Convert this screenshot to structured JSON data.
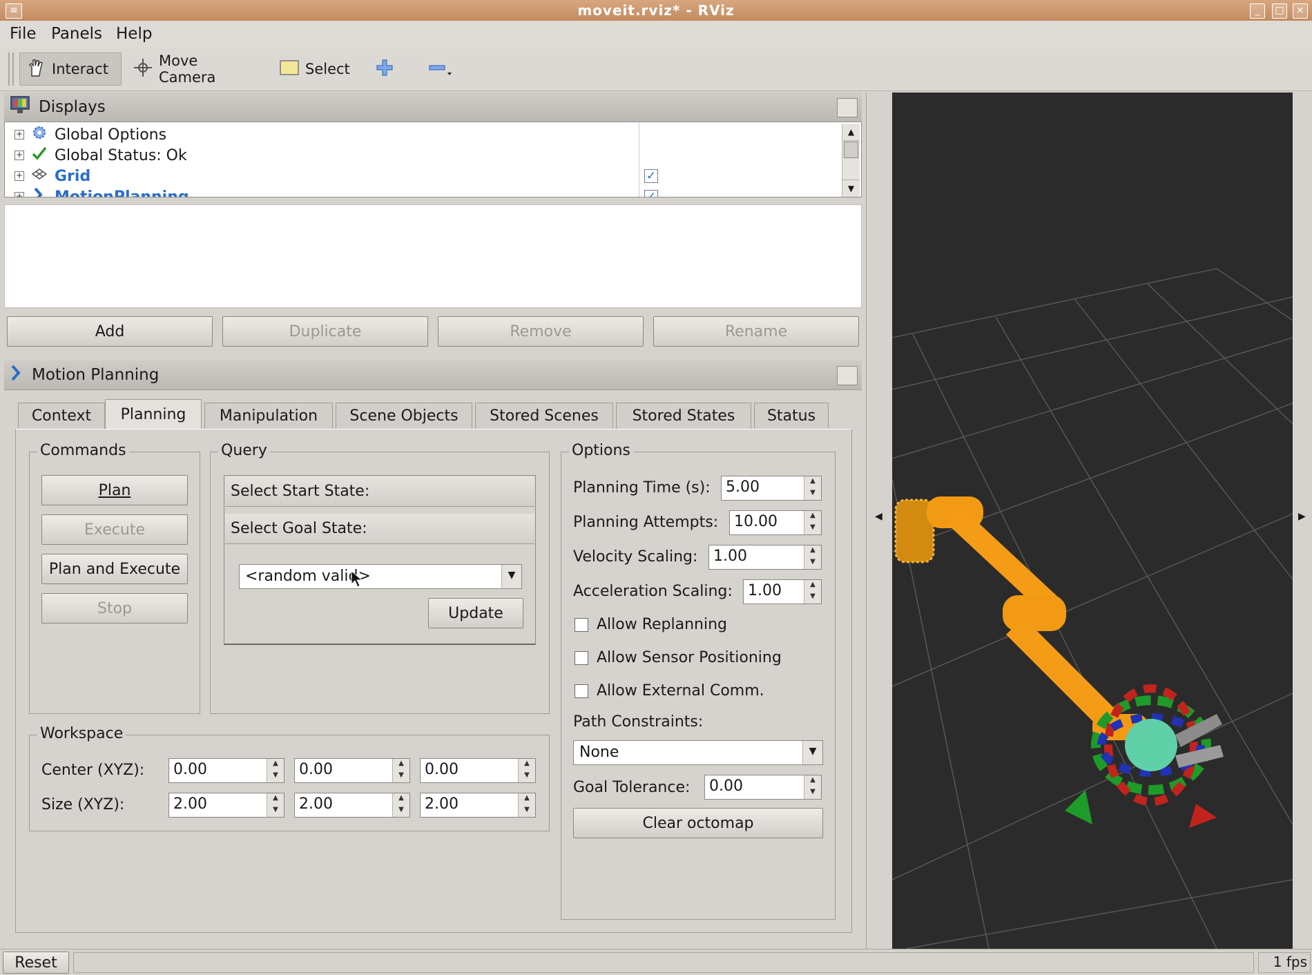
{
  "window": {
    "title": "moveit.rviz* - RViz"
  },
  "menu": [
    "File",
    "Panels",
    "Help"
  ],
  "toolbar": {
    "interact": "Interact",
    "move_camera": "Move Camera",
    "select": "Select"
  },
  "displays": {
    "title": "Displays",
    "tree": [
      {
        "label": "Global Options",
        "icon": "gear-icon"
      },
      {
        "label": "Global Status: Ok",
        "icon": "checkmark-icon"
      },
      {
        "label": "Grid",
        "icon": "grid-icon",
        "checked": true
      },
      {
        "label": "MotionPlanning",
        "icon": "motion-planning-icon",
        "checked": true
      }
    ],
    "buttons": {
      "add": "Add",
      "duplicate": "Duplicate",
      "remove": "Remove",
      "rename": "Rename"
    }
  },
  "motion_planning": {
    "title": "Motion Planning",
    "tabs": [
      "Context",
      "Planning",
      "Manipulation",
      "Scene Objects",
      "Stored Scenes",
      "Stored States",
      "Status"
    ],
    "active_tab": "Planning",
    "commands": {
      "label": "Commands",
      "plan": "Plan",
      "execute": "Execute",
      "plan_and_execute": "Plan and Execute",
      "stop": "Stop"
    },
    "query": {
      "label": "Query",
      "start_state": "Select Start State:",
      "goal_state": "Select Goal State:",
      "goal_value": "<random valid>",
      "update": "Update"
    },
    "options": {
      "label": "Options",
      "planning_time_label": "Planning Time (s):",
      "planning_time": "5.00",
      "planning_attempts_label": "Planning Attempts:",
      "planning_attempts": "10.00",
      "velocity_scaling_label": "Velocity Scaling:",
      "velocity_scaling": "1.00",
      "acceleration_scaling_label": "Acceleration Scaling:",
      "acceleration_scaling": "1.00",
      "allow_replanning": "Allow Replanning",
      "allow_sensor_positioning": "Allow Sensor Positioning",
      "allow_external_comm": "Allow External Comm.",
      "path_constraints_label": "Path Constraints:",
      "path_constraints": "None",
      "goal_tolerance_label": "Goal Tolerance:",
      "goal_tolerance": "0.00",
      "clear_octomap": "Clear octomap"
    },
    "workspace": {
      "label": "Workspace",
      "center_label": "Center (XYZ):",
      "center": [
        "0.00",
        "0.00",
        "0.00"
      ],
      "size_label": "Size (XYZ):",
      "size": [
        "2.00",
        "2.00",
        "2.00"
      ]
    }
  },
  "status": {
    "reset": "Reset",
    "fps": "1 fps"
  }
}
